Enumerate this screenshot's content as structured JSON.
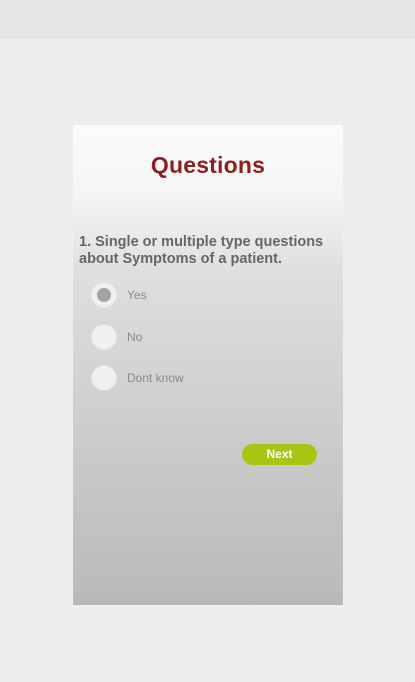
{
  "card": {
    "title": "Questions",
    "question": "1. Single or multiple type questions about Symptoms of a patient.",
    "options": [
      {
        "label": "Yes",
        "selected": true
      },
      {
        "label": "No",
        "selected": false
      },
      {
        "label": "Dont know",
        "selected": false
      }
    ],
    "next_label": "Next"
  },
  "colors": {
    "title": "#8e1f1f",
    "next_button": "#a7c512",
    "page_background": "#eeeeee"
  }
}
